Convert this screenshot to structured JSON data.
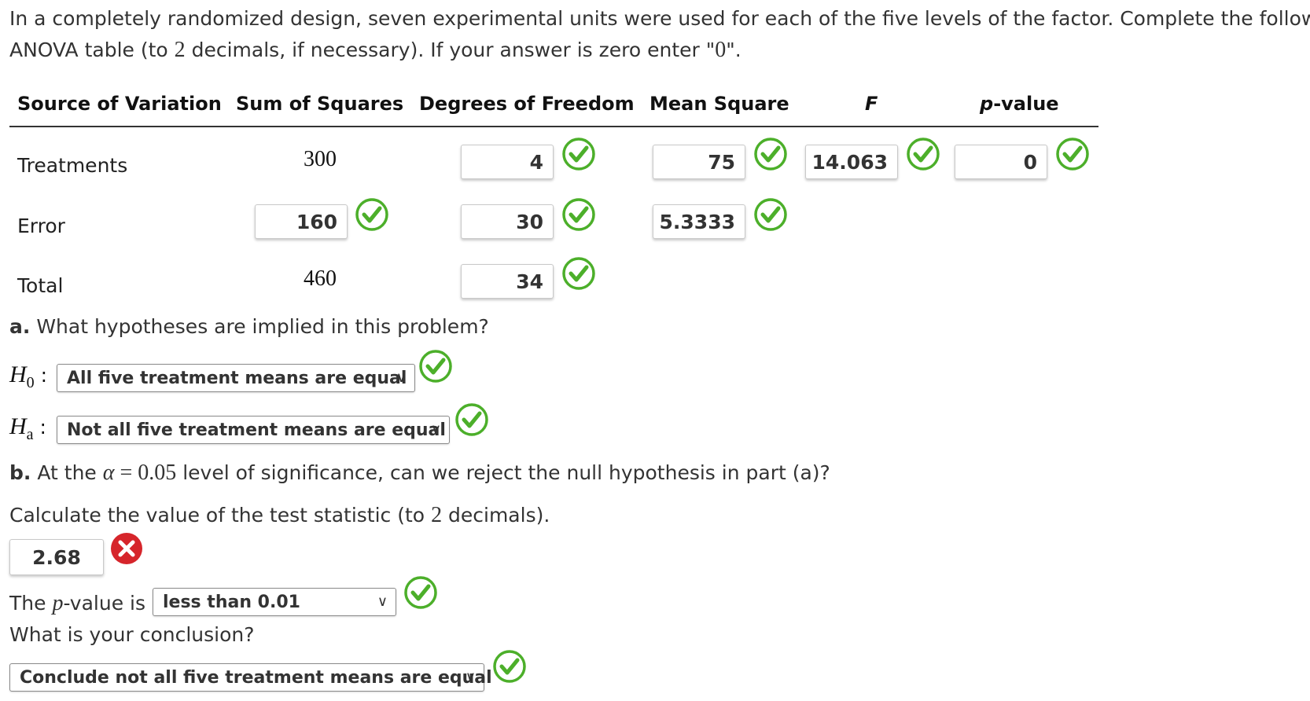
{
  "intro": {
    "line1": "In a completely randomized design, seven experimental units were used for each of the five levels of the factor. Complete the following",
    "line2_pre": "ANOVA table (to ",
    "line2_num": "2",
    "line2_mid": " decimals, if necessary). If your answer is zero enter \"",
    "line2_zero": "0",
    "line2_end": "\"."
  },
  "table": {
    "headers": [
      "Source of Variation",
      "Sum of Squares",
      "Degrees of Freedom",
      "Mean Square",
      "F",
      "p-value"
    ],
    "rows": [
      {
        "source": "Treatments",
        "ss": "300",
        "df": "4",
        "ms": "75",
        "f": "14.063",
        "p": "0"
      },
      {
        "source": "Error",
        "ss": "160",
        "df": "30",
        "ms": "5.3333"
      },
      {
        "source": "Total",
        "ss": "460",
        "df": "34"
      }
    ]
  },
  "part_a": {
    "prompt_letter": "a.",
    "prompt": " What hypotheses are implied in this problem?",
    "h0_symbol": "H",
    "h0_sub": "0",
    "h0_value": "All five treatment means are equal",
    "ha_symbol": "H",
    "ha_sub": "a",
    "ha_value": "Not all five treatment means are equal"
  },
  "part_b": {
    "prompt_letter": "b.",
    "prompt_pre": " At the ",
    "alpha": "α",
    "equals": " = ",
    "alpha_value": "0.05",
    "prompt_post": " level of significance, can we reject the null hypothesis in part (a)?",
    "calc_pre": "Calculate the value of the test statistic (to ",
    "calc_num": "2",
    "calc_post": " decimals).",
    "test_stat_value": "2.68",
    "pvalue_pre": "The ",
    "pvalue_p": "p",
    "pvalue_post": "-value is",
    "pvalue_select": "less than 0.01",
    "conclusion_prompt": "What is your conclusion?",
    "conclusion_select": "Conclude not all five treatment means are equal"
  },
  "icons": {
    "correct": "check-circle-icon",
    "incorrect": "x-circle-icon",
    "correct_color": "#4caf2a",
    "incorrect_color": "#d6252b"
  }
}
